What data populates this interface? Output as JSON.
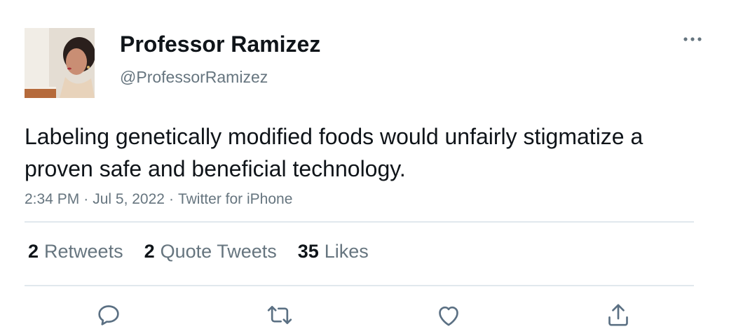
{
  "author": {
    "name": "Professor Ramizez",
    "handle": "@ProfessorRamizez"
  },
  "tweet": {
    "text": "Labeling genetically modified foods would unfairly stigmatize a proven safe and beneficial technology.",
    "time": "2:34 PM",
    "date": "Jul 5, 2022",
    "source": "Twitter for iPhone"
  },
  "stats": {
    "retweets_count": "2",
    "retweets_label": "Retweets",
    "quotes_count": "2",
    "quotes_label": "Quote Tweets",
    "likes_count": "35",
    "likes_label": "Likes"
  },
  "icons": {
    "more": "more-horizontal-icon",
    "reply": "reply-icon",
    "retweet": "retweet-icon",
    "like": "like-icon",
    "share": "share-icon"
  },
  "colors": {
    "text": "#0f1419",
    "secondary": "#66757f",
    "divider": "#e1e8ed",
    "icon": "#5b7083"
  }
}
